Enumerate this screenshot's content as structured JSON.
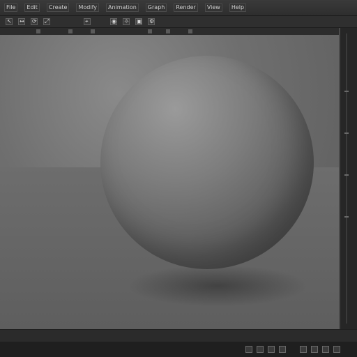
{
  "window": {
    "title": ""
  },
  "menubar": {
    "items": [
      "File",
      "Edit",
      "Create",
      "Modify",
      "Animation",
      "Graph",
      "Render",
      "View",
      "Help"
    ]
  },
  "toolbar": {
    "tools": [
      {
        "name": "select",
        "glyph": "↖"
      },
      {
        "name": "move",
        "glyph": "↔"
      },
      {
        "name": "rotate",
        "glyph": "⟳"
      },
      {
        "name": "scale",
        "glyph": "⤢"
      },
      {
        "name": "snap",
        "glyph": "⌖"
      },
      {
        "name": "camera",
        "glyph": "◉"
      },
      {
        "name": "light",
        "glyph": "☼"
      },
      {
        "name": "render",
        "glyph": "▣"
      },
      {
        "name": "settings",
        "glyph": "⚙"
      }
    ]
  },
  "timeline": {
    "text": ""
  },
  "status": {
    "icons": [
      "play-icon",
      "pause-icon",
      "record-icon",
      "settings-icon",
      "grid-icon",
      "camera-icon",
      "info-icon",
      "close-icon"
    ]
  },
  "colors": {
    "ui_dark": "#2b2b2b",
    "viewport_bg": "#6f6f6f",
    "sphere": "#7d7d7d"
  }
}
